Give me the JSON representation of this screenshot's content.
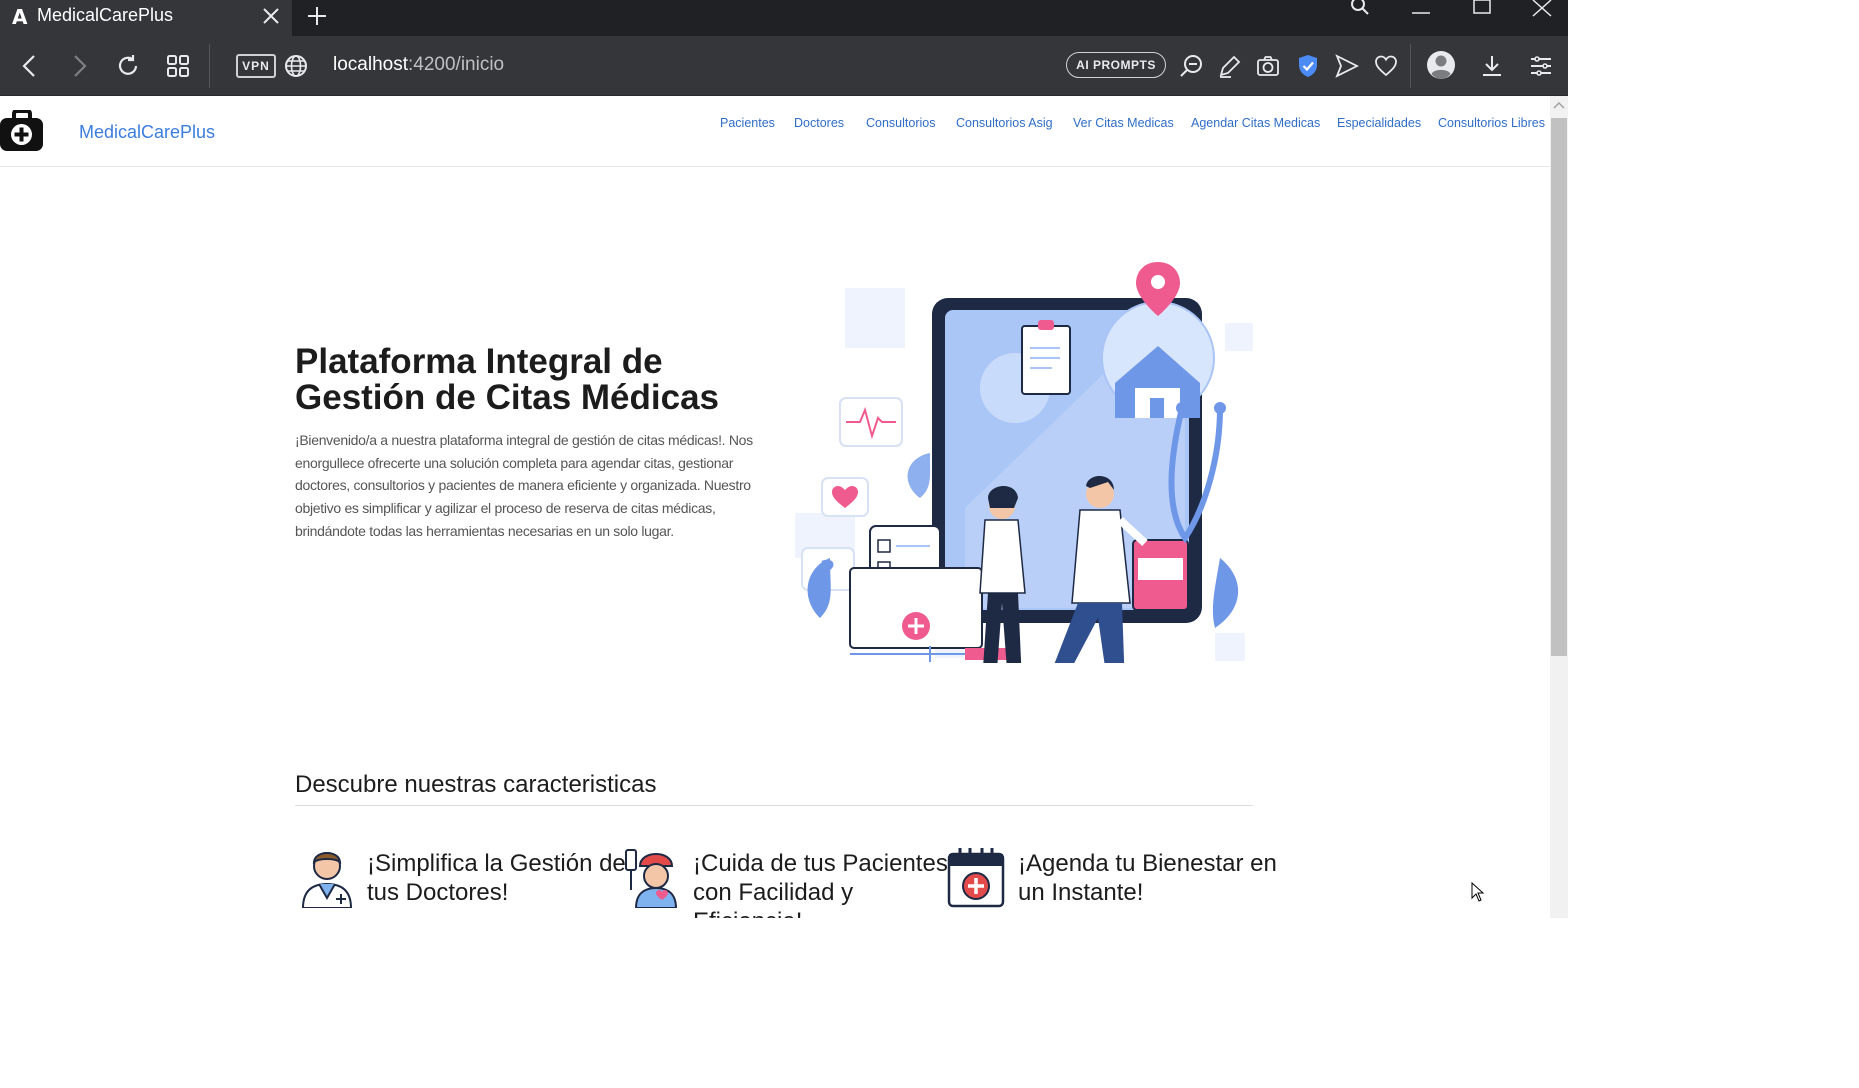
{
  "browser": {
    "tab_title": "MedicalCarePlus",
    "vpn_label": "VPN",
    "url_host": "localhost",
    "url_path": ":4200/inicio",
    "ai_prompts_label": "AI PROMPTS"
  },
  "navbar": {
    "brand": "MedicalCarePlus",
    "links": [
      "Pacientes",
      "Doctores",
      "Consultorios",
      "Consultorios Asig",
      "Ver Citas Medicas",
      "Agendar Citas Medicas",
      "Especialidades",
      "Consultorios Libres"
    ]
  },
  "hero": {
    "title": "Plataforma Integral de Gestión de Citas Médicas",
    "text": "¡Bienvenido/a a nuestra plataforma integral de gestión de citas médicas!. Nos enorgullece ofrecerte una solución completa para agendar citas, gestionar doctores, consultorios y pacientes de manera eficiente y organizada. Nuestro objetivo es simplificar y agilizar el proceso de reserva de citas médicas, brindándote todas las herramientas necesarias en un solo lugar."
  },
  "features": {
    "title": "Descubre nuestras caracteristicas",
    "items": [
      {
        "title": "¡Simplifica la Gestión de tus Doctores!",
        "icon": "doctor-icon"
      },
      {
        "title": "¡Cuida de tus Pacientes con Facilidad y Eficiencia!",
        "icon": "patient-icon"
      },
      {
        "title": "¡Agenda tu Bienestar en un Instante!",
        "icon": "calendar-icon"
      }
    ]
  },
  "colors": {
    "accent": "#3b7ddd",
    "chrome": "#35363a",
    "illustration_pink": "#ef5b8f",
    "illustration_blue": "#a9c4f5"
  }
}
